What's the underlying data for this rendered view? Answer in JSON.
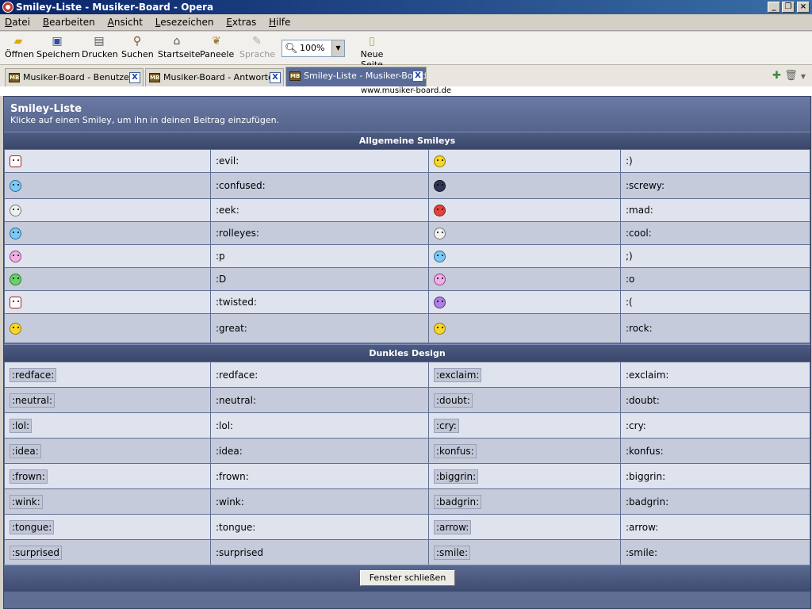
{
  "window": {
    "title": "Smiley-Liste - Musiker-Board - Opera"
  },
  "menu": [
    "Datei",
    "Bearbeiten",
    "Ansicht",
    "Lesezeichen",
    "Extras",
    "Hilfe"
  ],
  "toolbar": {
    "open": "Öffnen",
    "save": "Speichern",
    "print": "Drucken",
    "search": "Suchen",
    "home": "Startseite",
    "panels": "Paneele",
    "language": "Sprache",
    "zoom": "100%",
    "new_page": "Neue Seite"
  },
  "tabs": [
    {
      "label": "Musiker-Board - Benutzer..."
    },
    {
      "label": "Musiker-Board - Antworten"
    },
    {
      "label": "Smiley-Liste - Musiker-Board"
    }
  ],
  "url": "www.musiker-board.de",
  "page": {
    "title": "Smiley-Liste",
    "subtitle": "Klicke auf einen Smiley, um ihn in deinen Beitrag einzufügen.",
    "section1": "Allgemeine Smileys",
    "section2": "Dunkles Design",
    "close_button": "Fenster schließen"
  },
  "general_smileys": [
    {
      "left_code": ":evil:",
      "left_icon": "devil",
      "right_code": ":)",
      "right_icon": "yellow"
    },
    {
      "left_code": ":confused:",
      "left_icon": "blue",
      "right_code": ":screwy:",
      "right_icon": "dark"
    },
    {
      "left_code": ":eek:",
      "left_icon": "grey",
      "right_code": ":mad:",
      "right_icon": "red"
    },
    {
      "left_code": ":rolleyes:",
      "left_icon": "blue",
      "right_code": ":cool:",
      "right_icon": "grey"
    },
    {
      "left_code": ":p",
      "left_icon": "pink",
      "right_code": ";)",
      "right_icon": "blue"
    },
    {
      "left_code": ":D",
      "left_icon": "green",
      "right_code": ":o",
      "right_icon": "pink"
    },
    {
      "left_code": ":twisted:",
      "left_icon": "devil",
      "right_code": ":(",
      "right_icon": "purple"
    },
    {
      "left_code": ":great:",
      "left_icon": "yellow",
      "right_code": ":rock:",
      "right_icon": "yellow"
    }
  ],
  "dark_smileys": [
    {
      "left": ":redface:",
      "right": ":exclaim:"
    },
    {
      "left": ":neutral:",
      "right": ":doubt:"
    },
    {
      "left": ":lol:",
      "right": ":cry:"
    },
    {
      "left": ":idea:",
      "right": ":konfus:"
    },
    {
      "left": ":frown:",
      "right": ":biggrin:"
    },
    {
      "left": ":wink:",
      "right": ":badgrin:"
    },
    {
      "left": ":tongue:",
      "right": ":arrow:"
    },
    {
      "left": ":surprised",
      "right": ":smile:"
    }
  ]
}
